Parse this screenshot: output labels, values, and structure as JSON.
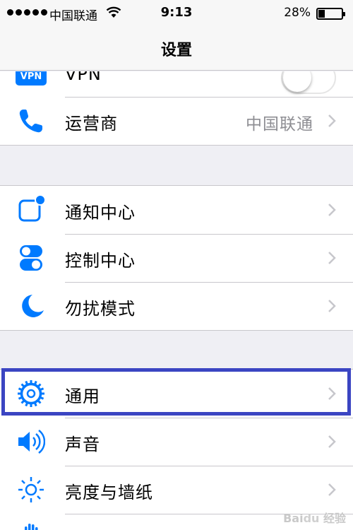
{
  "status_bar": {
    "carrier": "中国联通",
    "time": "9:13",
    "battery_percent": "28%",
    "battery_level": 0.28,
    "signal_dots": 5
  },
  "nav": {
    "title": "设置"
  },
  "group1": {
    "vpn": {
      "badge": "VPN",
      "label": "VPN",
      "toggle_on": false
    },
    "carrier": {
      "label": "运营商",
      "value": "中国联通",
      "icon": "phone-icon"
    }
  },
  "group2": [
    {
      "label": "通知中心",
      "icon": "notification-center-icon"
    },
    {
      "label": "控制中心",
      "icon": "control-center-icon"
    },
    {
      "label": "勿扰模式",
      "icon": "moon-icon"
    }
  ],
  "group3": [
    {
      "label": "通用",
      "icon": "gear-icon",
      "highlighted": true
    },
    {
      "label": "声音",
      "icon": "speaker-icon"
    },
    {
      "label": "亮度与墙纸",
      "icon": "brightness-icon"
    }
  ],
  "colors": {
    "accent": "#007aff",
    "highlight": "#3b45c2",
    "background": "#efeff4"
  }
}
